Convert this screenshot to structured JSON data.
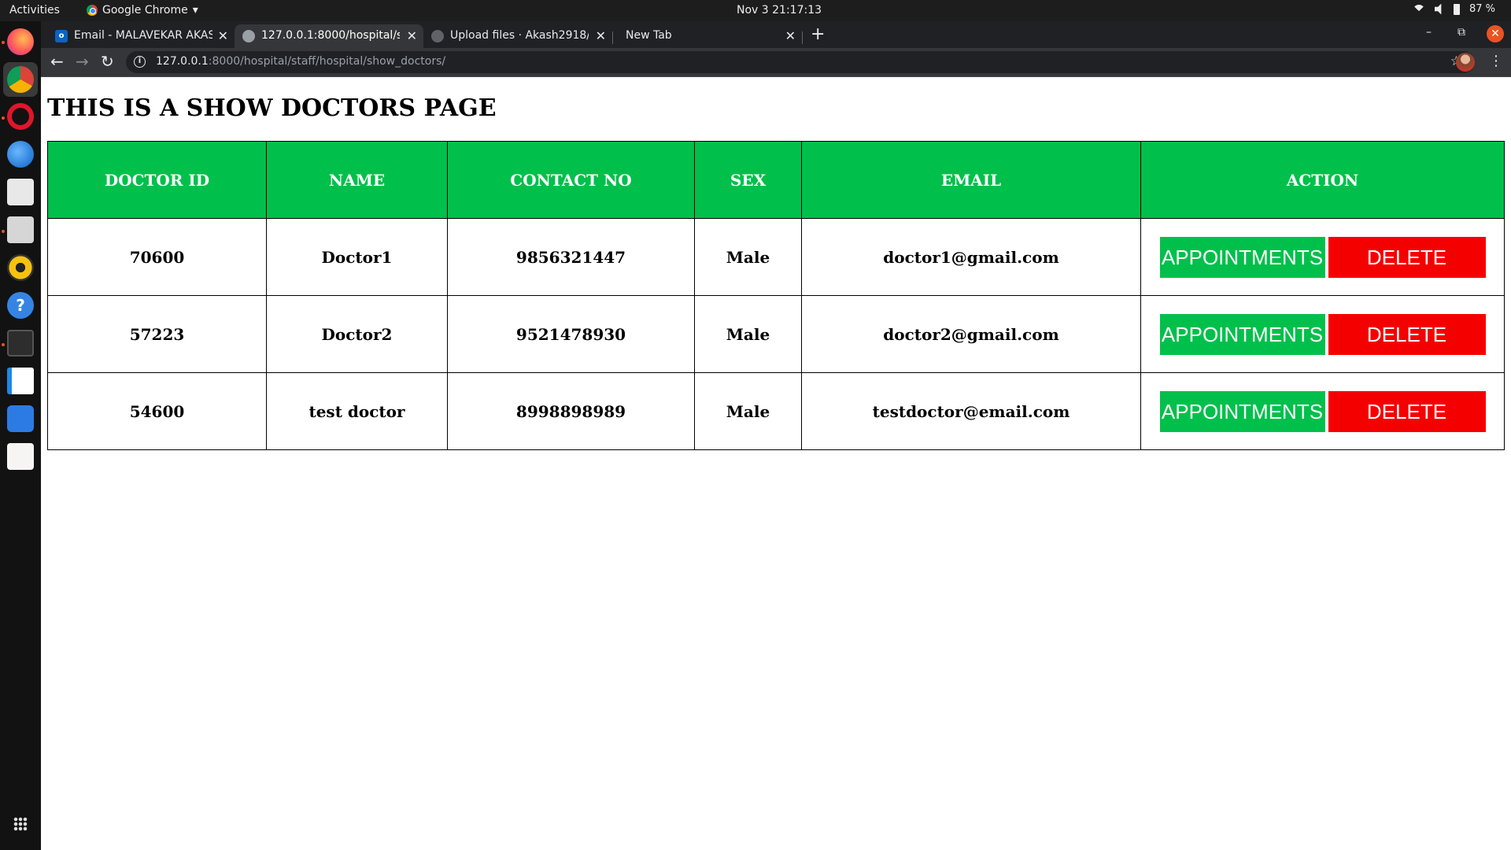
{
  "system": {
    "activities": "Activities",
    "app_name": "Google Chrome",
    "clock": "Nov 3  21:17:13",
    "battery": "87 %"
  },
  "browser": {
    "tabs": [
      {
        "title": "Email - MALAVEKAR AKAS",
        "favicon": "outlook-icon"
      },
      {
        "title": "127.0.0.1:8000/hospital/s",
        "favicon": "globe-icon"
      },
      {
        "title": "Upload files · Akash2918/",
        "favicon": "github-icon"
      },
      {
        "title": "New Tab",
        "favicon": ""
      }
    ],
    "url_host": "127.0.0.1",
    "url_rest": ":8000/hospital/staff/hospital/show_doctors/"
  },
  "page": {
    "heading": "THIS IS A SHOW DOCTORS PAGE",
    "columns": [
      "DOCTOR ID",
      "NAME",
      "CONTACT NO",
      "SEX",
      "EMAIL",
      "ACTION"
    ],
    "rows": [
      {
        "id": "70600",
        "name": "Doctor1",
        "contact": "9856321447",
        "sex": "Male",
        "email": "doctor1@gmail.com"
      },
      {
        "id": "57223",
        "name": "Doctor2",
        "contact": "9521478930",
        "sex": "Male",
        "email": "doctor2@gmail.com"
      },
      {
        "id": "54600",
        "name": "test doctor",
        "contact": "8998898989",
        "sex": "Male",
        "email": "testdoctor@email.com"
      }
    ],
    "appointments_label": "APPOINTMENTS",
    "delete_label": "DELETE"
  },
  "colors": {
    "header_green": "#00c04b",
    "delete_red": "#f50000"
  }
}
